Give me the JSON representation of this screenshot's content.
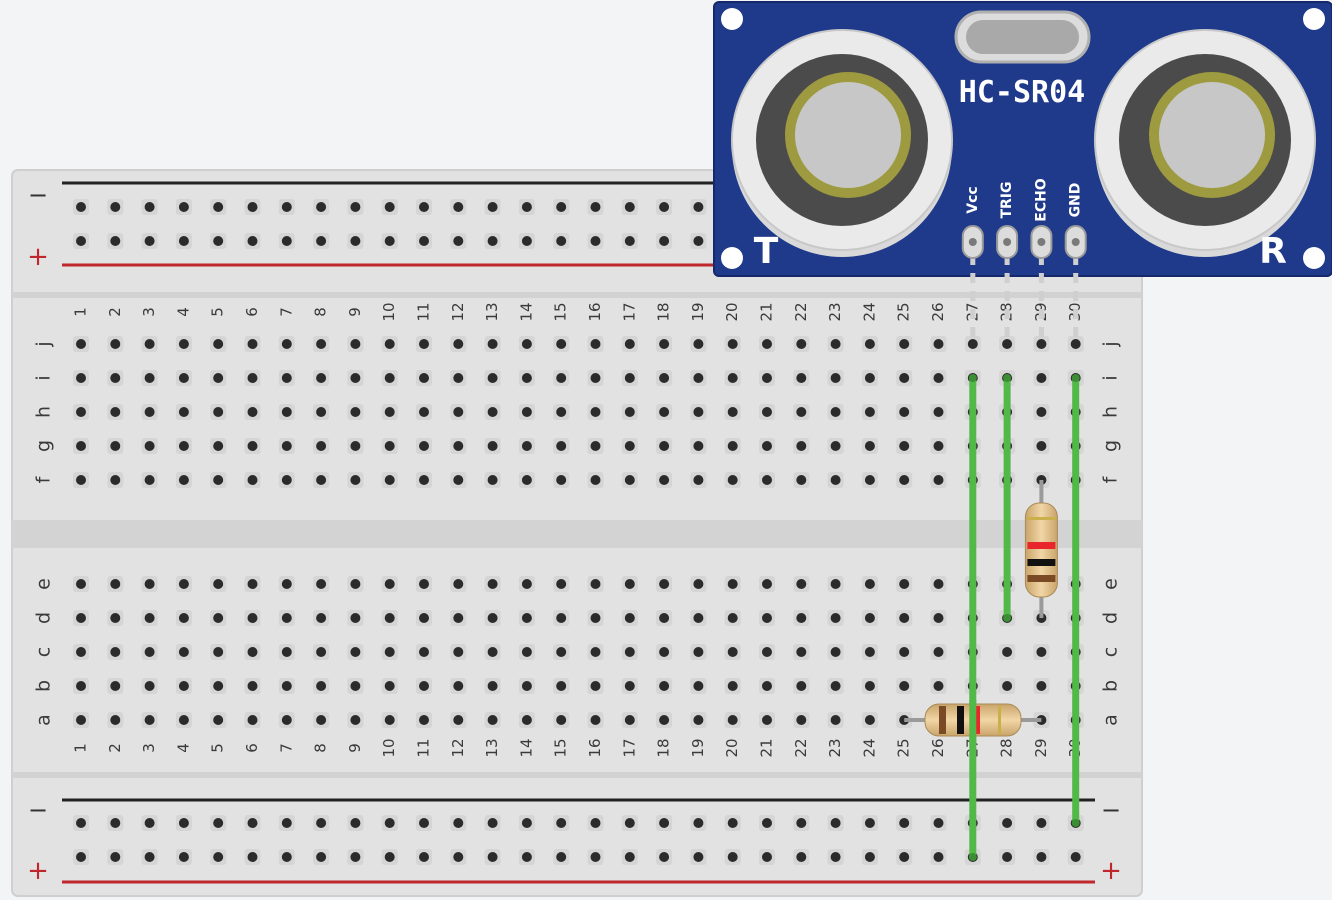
{
  "sensor": {
    "model": "HC-SR04",
    "transmitter_label": "T",
    "receiver_label": "R",
    "pins": [
      "Vcc",
      "TRIG",
      "ECHO",
      "GND"
    ],
    "board_color": "#1f3a8a"
  },
  "breadboard": {
    "columns": 30,
    "top_rows": [
      "j",
      "i",
      "h",
      "g",
      "f"
    ],
    "bottom_rows": [
      "e",
      "d",
      "c",
      "b",
      "a"
    ],
    "rail_minus": "−",
    "rail_plus": "+",
    "rail_minus_color": "#222222",
    "rail_plus_color": "#c0272d"
  },
  "wires": {
    "color": "#52b848",
    "list": [
      {
        "from": "sensor Vcc (col 27, row i)",
        "to": "bottom + rail"
      },
      {
        "from": "sensor TRIG (col 28, row i)",
        "to": "col 28 row d"
      },
      {
        "from": "sensor GND (col 30, row i)",
        "to": "bottom − rail"
      }
    ]
  },
  "resistors": [
    {
      "placement": "vertical, column 29, rows f–d",
      "bands": [
        "brown",
        "black",
        "red",
        "gold"
      ]
    },
    {
      "placement": "horizontal, row a, columns 25–29",
      "bands": [
        "brown",
        "black",
        "red",
        "gold"
      ]
    }
  ]
}
